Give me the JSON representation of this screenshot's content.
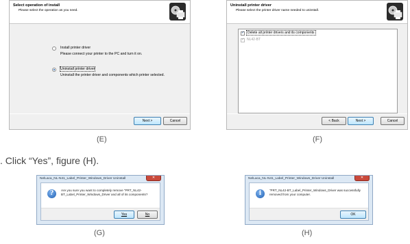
{
  "window_e": {
    "title": "Select operation of install",
    "subtitle": "Please select the operation as you need.",
    "options": [
      {
        "label": "Install printer driver",
        "description": "Please connect your printer to the PC and turn it on.",
        "selected": false
      },
      {
        "label": "Uninstall printer driver",
        "description": "Uninstall the printer driver and components which printer selected.",
        "selected": true
      }
    ],
    "next_label": "Next >",
    "cancel_label": "Cancel",
    "caption": "(E)"
  },
  "window_f": {
    "title": "Uninstall printer driver",
    "subtitle": "Please select the printer driver name needed to uninstall.",
    "delete_all_label": "Delete all printer drivers and its components",
    "driver_item": "NL42-BT",
    "back_label": "< Back",
    "next_label": "Next >",
    "cancel_label": "Cancel",
    "caption": "(F)"
  },
  "instruction": ". Click “Yes”, figure (H).",
  "dialog_g": {
    "title": "NelLaca_NL-N41_Label_Printer_Windows_Driver Uninstall",
    "message": "Are you sure you want to completely remove “PRT_NL42-BT_Label_Printer_Windows_Driver and all of its components?",
    "yes_label": "Yes",
    "no_label": "No",
    "caption": "(G)"
  },
  "dialog_h": {
    "title": "NelLaca_NL-N41_Label_Printer_Windows_Driver Uninstall",
    "message": "“PRT_NL42-BT_Label_Printer_Windows_Driver was successfully removed from your computer.",
    "ok_label": "OK",
    "caption": "(H)"
  },
  "icons": {
    "installer_logo": "printer-disc-icon",
    "question": "question-icon",
    "info": "info-icon",
    "close": "close-icon"
  }
}
